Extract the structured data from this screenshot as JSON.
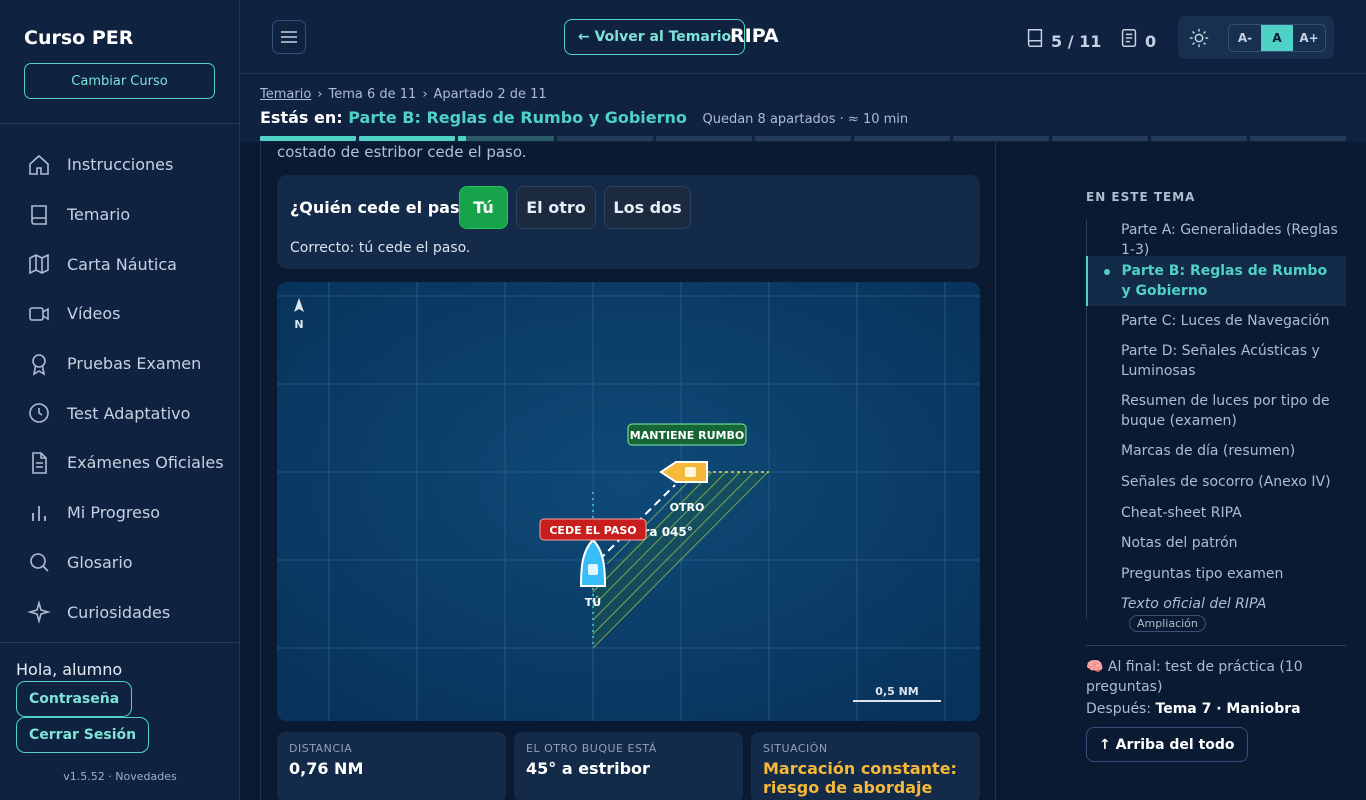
{
  "sidebar": {
    "brand": "Curso PER",
    "change_course": "Cambiar Curso",
    "nav": [
      {
        "label": "Instrucciones",
        "icon": "home-icon"
      },
      {
        "label": "Temario",
        "icon": "book-icon"
      },
      {
        "label": "Carta Náutica",
        "icon": "map-icon"
      },
      {
        "label": "Vídeos",
        "icon": "video-icon"
      },
      {
        "label": "Pruebas Examen",
        "icon": "award-icon"
      },
      {
        "label": "Test Adaptativo",
        "icon": "clock-icon"
      },
      {
        "label": "Exámenes Oficiales",
        "icon": "document-icon"
      },
      {
        "label": "Mi Progreso",
        "icon": "bar-chart-icon"
      },
      {
        "label": "Glosario",
        "icon": "search-icon"
      },
      {
        "label": "Curiosidades",
        "icon": "sparkle-icon"
      }
    ],
    "greeting": "Hola, alumno",
    "password": "Contraseña",
    "logout": "Cerrar Sesión",
    "version": "v1.5.52 · Novedades"
  },
  "topbar": {
    "back": "← Volver al Temario",
    "title": "RIPA",
    "pages": "5 / 11",
    "notes": "0",
    "font_small": "A-",
    "font_normal": "A",
    "font_large": "A+"
  },
  "subhead": {
    "crumb_root": "Temario",
    "crumb_tema": "Tema 6 de 11",
    "crumb_apartado": "Apartado 2 de 11",
    "here_prefix": "Estás en:",
    "here_current": "Parte B: Reglas de Rumbo y Gobierno",
    "remaining": "Quedan 8 apartados · ≈ 10 min",
    "progress_segments": 11,
    "progress_fraction": 0.19
  },
  "main": {
    "cut_text": "costado de estribor cede el paso.",
    "quiz": {
      "question": "¿Quién cede el paso?",
      "options": [
        "Tú",
        "El otro",
        "Los dos"
      ],
      "selected": "Tú",
      "feedback": "Correcto: tú cede el paso."
    },
    "chart": {
      "north": "N",
      "other_label": "MANTIENE RUMBO",
      "other_name": "OTRO",
      "you_label": "CEDE EL PASO",
      "you_name": "TÚ",
      "bearing_text": "ora 045°",
      "scale": "0,5 NM"
    },
    "cards": [
      {
        "label": "DISTANCIA",
        "value": "0,76 NM"
      },
      {
        "label": "EL OTRO BUQUE ESTÁ",
        "value": "45° a estribor"
      },
      {
        "label": "SITUACIÓN",
        "value": "Marcación constante: riesgo de abordaje"
      }
    ]
  },
  "toc": {
    "title": "EN ESTE TEMA",
    "items": [
      {
        "label": "Parte A: Generalidades (Reglas 1-3)"
      },
      {
        "label": "Parte B: Reglas de Rumbo y Gobierno"
      },
      {
        "label": "Parte C: Luces de Navegación"
      },
      {
        "label": "Parte D: Señales Acústicas y Luminosas"
      },
      {
        "label": "Resumen de luces por tipo de buque (examen)"
      },
      {
        "label": "Marcas de día (resumen)"
      },
      {
        "label": "Señales de socorro (Anexo IV)"
      },
      {
        "label": "Cheat-sheet RIPA"
      },
      {
        "label": "Notas del patrón"
      },
      {
        "label": "Preguntas tipo examen"
      },
      {
        "label": "Texto oficial del RIPA",
        "badge": "Ampliación"
      }
    ],
    "final": "🧠 Al final: test de práctica (10 preguntas)",
    "after_prefix": "Después:",
    "after_value": "Tema 7 · Maniobra",
    "top_button": "↑ Arriba del todo"
  },
  "colors": {
    "accent": "#4fd1c5",
    "correct": "#16a34a",
    "give_way": "#c81e1e",
    "stand_on": "#166534",
    "warning": "#f5b93a"
  }
}
